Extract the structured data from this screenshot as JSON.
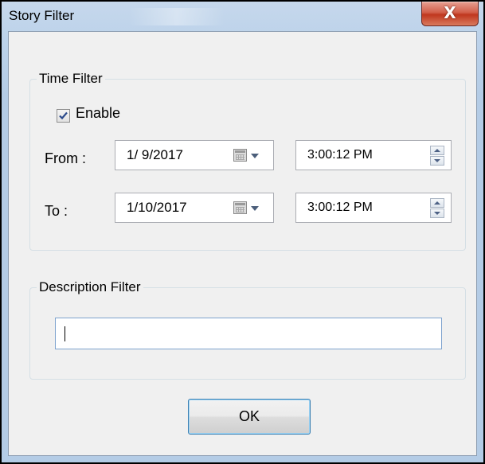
{
  "window": {
    "title": "Story Filter",
    "close_glyph": "X",
    "close_icon": "close-icon"
  },
  "time_filter": {
    "legend": "Time Filter",
    "enable_label": "Enable",
    "enabled": true,
    "from_label": "From :",
    "from_date": "1/ 9/2017",
    "from_time": "3:00:12 PM",
    "to_label": "To :",
    "to_date": "1/10/2017",
    "to_time": "3:00:12 PM",
    "calendar_icon": "calendar-icon",
    "dropdown_icon": "chevron-down-icon"
  },
  "description_filter": {
    "legend": "Description Filter",
    "value": ""
  },
  "buttons": {
    "ok_label": "OK"
  },
  "colors": {
    "title_bar": "#bcd2ea",
    "close_button": "#c0371e",
    "dialog_background": "#f0f0f0",
    "focus_border": "#3c7fb1"
  }
}
